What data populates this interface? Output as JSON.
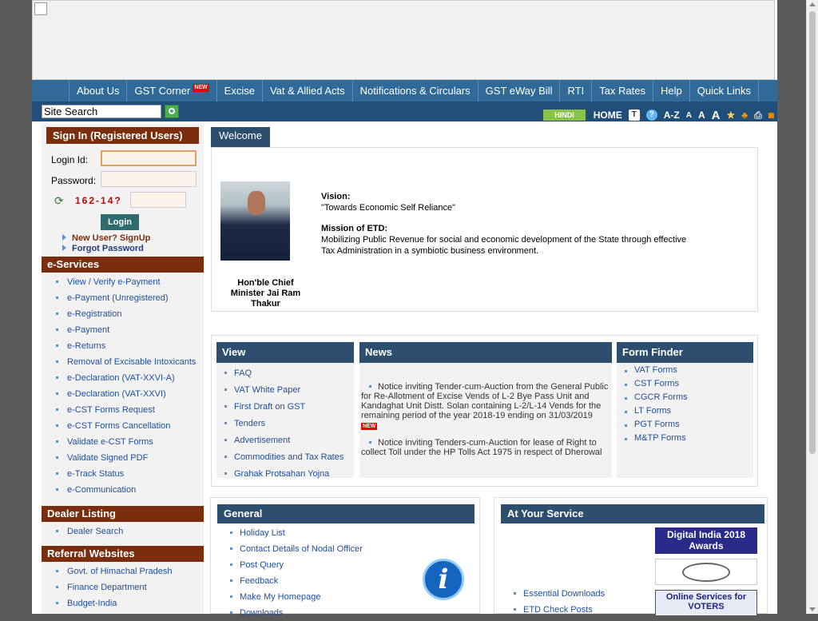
{
  "nav": {
    "items": [
      "About Us",
      "GST Corner",
      "Excise",
      "Vat & Allied Acts",
      "Notifications & Circulars",
      "GST eWay Bill",
      "RTI",
      "Tax Rates",
      "Help",
      "Quick Links"
    ],
    "new_badge": "NEW"
  },
  "toolbar": {
    "search_value": "Site Search",
    "hindi": "HINDI",
    "home": "HOME",
    "az": "A-Z",
    "font_small": "A",
    "font_medium": "A",
    "font_large": "A"
  },
  "signin": {
    "title": "Sign In (Registered Users)",
    "login_label": "Login Id:",
    "password_label": "Password:",
    "captcha": "162-14?",
    "login_button": "Login",
    "new_user": "New User? SignUp",
    "forgot": "Forgot Password"
  },
  "eservices": {
    "title": "e-Services",
    "items": [
      "View / Verify e-Payment",
      "e-Payment (Unregistered)",
      "e-Registration",
      "e-Payment",
      "e-Returns",
      "Removal of Excisable Intoxicants",
      "e-Declaration (VAT-XXVI-A)",
      "e-Declaration (VAT-XXVI)",
      "e-CST Forms Request",
      "e-CST Forms Cancellation",
      "Validate e-CST Forms",
      "Validate Signed PDF",
      "e-Track Status",
      "e-Communication"
    ]
  },
  "dealer": {
    "title": "Dealer Listing",
    "items": [
      "Dealer Search"
    ]
  },
  "referral": {
    "title": "Referral Websites",
    "items": [
      "Govt. of Himachal Pradesh",
      "Finance Department",
      "Budget-India"
    ]
  },
  "welcome": {
    "tab": "Welcome",
    "cm_caption": "Hon'ble Chief Minister Jai Ram Thakur",
    "vision_label": "Vision:",
    "vision_text": "\"Towards Economic Self Reliance\"",
    "mission_label": "Mission of ETD:",
    "mission_text": "Mobilizing Public Revenue for social and economic development of the State through effective Tax Administration in a symbiotic business environment."
  },
  "view": {
    "title": "View",
    "items": [
      "FAQ",
      "VAT White Paper",
      "First Draft on GST",
      "Tenders",
      "Advertisement",
      "Commodities and Tax Rates",
      "Grahak Protsahan Yojna"
    ]
  },
  "news": {
    "title": "News",
    "items": [
      "Notice inviting Tender-cum-Auction from the General Public for Re-Allotment of Excise Vends of L-2 Bye Pass Unit and Kandaghat Unit Distt. Solan containing L-2/L-14 Vends for the remaining period of the year 2018-19 ending on 31/03/2019",
      "Notice inviting Tenders-cum-Auction for lease of Right to collect Toll under the HP Tolls Act 1975 in respect of Dherowal Toll Unit Revenue Distt. BBN Baddi for the remaining period of"
    ],
    "new_badge": "NEW"
  },
  "form_finder": {
    "title": "Form Finder",
    "items": [
      "VAT Forms",
      "CST Forms",
      "CGCR Forms",
      "LT Forms",
      "PGT Forms",
      "M&TP Forms"
    ]
  },
  "general": {
    "title": "General",
    "items": [
      "Holiday List",
      "Contact Details of Nodal Officer",
      "Post Query",
      "Feedback",
      "Make My Homepage",
      "Downloads"
    ]
  },
  "service": {
    "title": "At Your Service",
    "items": [
      "Essential Downloads",
      "ETD Check Posts"
    ],
    "digital_india": "Digital India 2018 Awards",
    "voters": "Online Services for VOTERS"
  }
}
